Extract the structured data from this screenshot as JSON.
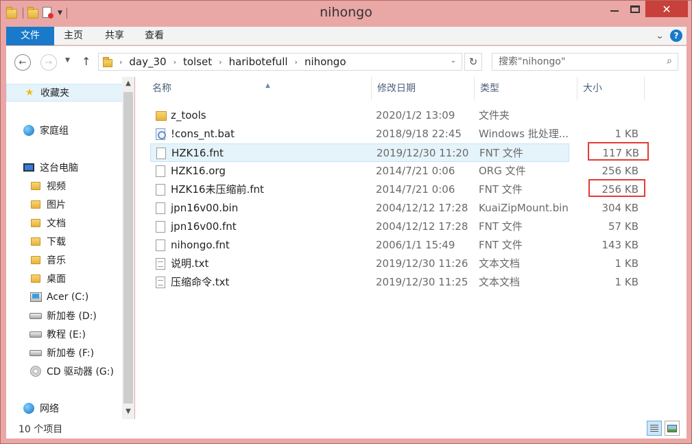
{
  "window": {
    "title": "nihongo"
  },
  "ribbon": {
    "tabs": [
      {
        "label": "文件"
      },
      {
        "label": "主页"
      },
      {
        "label": "共享"
      },
      {
        "label": "查看"
      }
    ],
    "help_label": "?"
  },
  "address": {
    "crumbs": [
      "day_30",
      "tolset",
      "haribotefull",
      "nihongo"
    ]
  },
  "search": {
    "placeholder": "搜索\"nihongo\""
  },
  "nav_pane": {
    "favorites": {
      "label": "收藏夹",
      "icon": "star-icon"
    },
    "homegroup": {
      "label": "家庭组",
      "icon": "homegroup-icon"
    },
    "this_pc": {
      "label": "这台电脑",
      "icon": "computer-icon"
    },
    "pc_items": [
      {
        "label": "视频",
        "icon": "folder-icon"
      },
      {
        "label": "图片",
        "icon": "folder-icon"
      },
      {
        "label": "文档",
        "icon": "folder-icon"
      },
      {
        "label": "下载",
        "icon": "folder-icon"
      },
      {
        "label": "音乐",
        "icon": "folder-icon"
      },
      {
        "label": "桌面",
        "icon": "folder-icon"
      },
      {
        "label": "Acer (C:)",
        "icon": "windows-drive-icon"
      },
      {
        "label": "新加卷 (D:)",
        "icon": "drive-icon"
      },
      {
        "label": "教程 (E:)",
        "icon": "drive-icon"
      },
      {
        "label": "新加卷 (F:)",
        "icon": "drive-icon"
      },
      {
        "label": "CD 驱动器 (G:)",
        "icon": "cd-drive-icon"
      }
    ],
    "network": {
      "label": "网络",
      "icon": "network-icon"
    }
  },
  "columns": {
    "name": "名称",
    "date": "修改日期",
    "type": "类型",
    "size": "大小"
  },
  "files": [
    {
      "name": "z_tools",
      "date": "2020/1/2 13:09",
      "type": "文件夹",
      "size": "",
      "icon": "folder"
    },
    {
      "name": "!cons_nt.bat",
      "date": "2018/9/18 22:45",
      "type": "Windows 批处理...",
      "size": "1 KB",
      "icon": "bat"
    },
    {
      "name": "HZK16.fnt",
      "date": "2019/12/30 11:20",
      "type": "FNT 文件",
      "size": "117 KB",
      "icon": "file",
      "selected": true
    },
    {
      "name": "HZK16.org",
      "date": "2014/7/21 0:06",
      "type": "ORG 文件",
      "size": "256 KB",
      "icon": "file"
    },
    {
      "name": "HZK16未压缩前.fnt",
      "date": "2014/7/21 0:06",
      "type": "FNT 文件",
      "size": "256 KB",
      "icon": "file"
    },
    {
      "name": "jpn16v00.bin",
      "date": "2004/12/12 17:28",
      "type": "KuaiZipMount.bin",
      "size": "304 KB",
      "icon": "file"
    },
    {
      "name": "jpn16v00.fnt",
      "date": "2004/12/12 17:28",
      "type": "FNT 文件",
      "size": "57 KB",
      "icon": "file"
    },
    {
      "name": "nihongo.fnt",
      "date": "2006/1/1 15:49",
      "type": "FNT 文件",
      "size": "143 KB",
      "icon": "file"
    },
    {
      "name": "说明.txt",
      "date": "2019/12/30 11:26",
      "type": "文本文档",
      "size": "1 KB",
      "icon": "txt"
    },
    {
      "name": "压缩命令.txt",
      "date": "2019/12/30 11:25",
      "type": "文本文档",
      "size": "1 KB",
      "icon": "txt"
    }
  ],
  "status": {
    "item_count": "10 个项目"
  },
  "colors": {
    "accent": "#1979ca",
    "title_bar": "#e9a7a5",
    "highlight_box": "#e53935",
    "close_button": "#c7403a"
  }
}
